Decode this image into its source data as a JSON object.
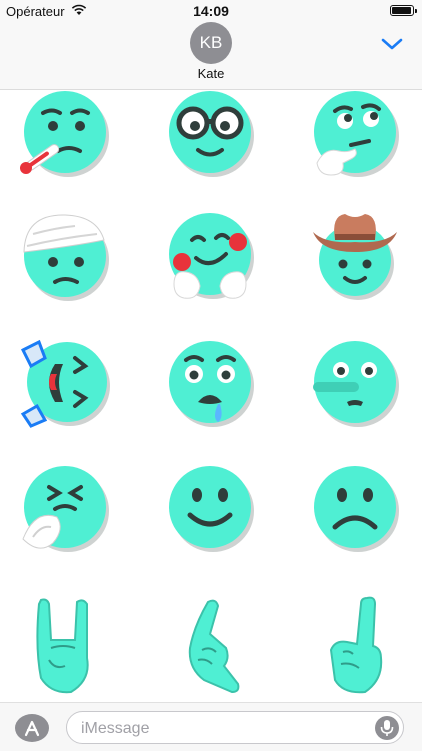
{
  "status_bar": {
    "carrier": "Opérateur",
    "time": "14:09",
    "battery_level": 0.95
  },
  "header": {
    "avatar_initials": "KB",
    "contact_name": "Kate"
  },
  "colors": {
    "face": "#4fefd3",
    "ink": "#2f3e3b",
    "accent_blue": "#1a7cf5",
    "cheek": "#e8333b",
    "hat": "#b0694f"
  },
  "stickers": [
    {
      "icon": "sick-thermometer-face"
    },
    {
      "icon": "nerd-glasses-face"
    },
    {
      "icon": "thinking-face"
    },
    {
      "icon": "bandaged-head-face"
    },
    {
      "icon": "hugging-face"
    },
    {
      "icon": "cowboy-face"
    },
    {
      "icon": "rolling-laughing-face"
    },
    {
      "icon": "drooling-face"
    },
    {
      "icon": "lying-face"
    },
    {
      "icon": "sneezing-face"
    },
    {
      "icon": "smiling-face"
    },
    {
      "icon": "frowning-face"
    },
    {
      "icon": "rock-on-hand"
    },
    {
      "icon": "call-me-hand"
    },
    {
      "icon": "pointing-up-hand"
    }
  ],
  "input_bar": {
    "placeholder": "iMessage"
  }
}
